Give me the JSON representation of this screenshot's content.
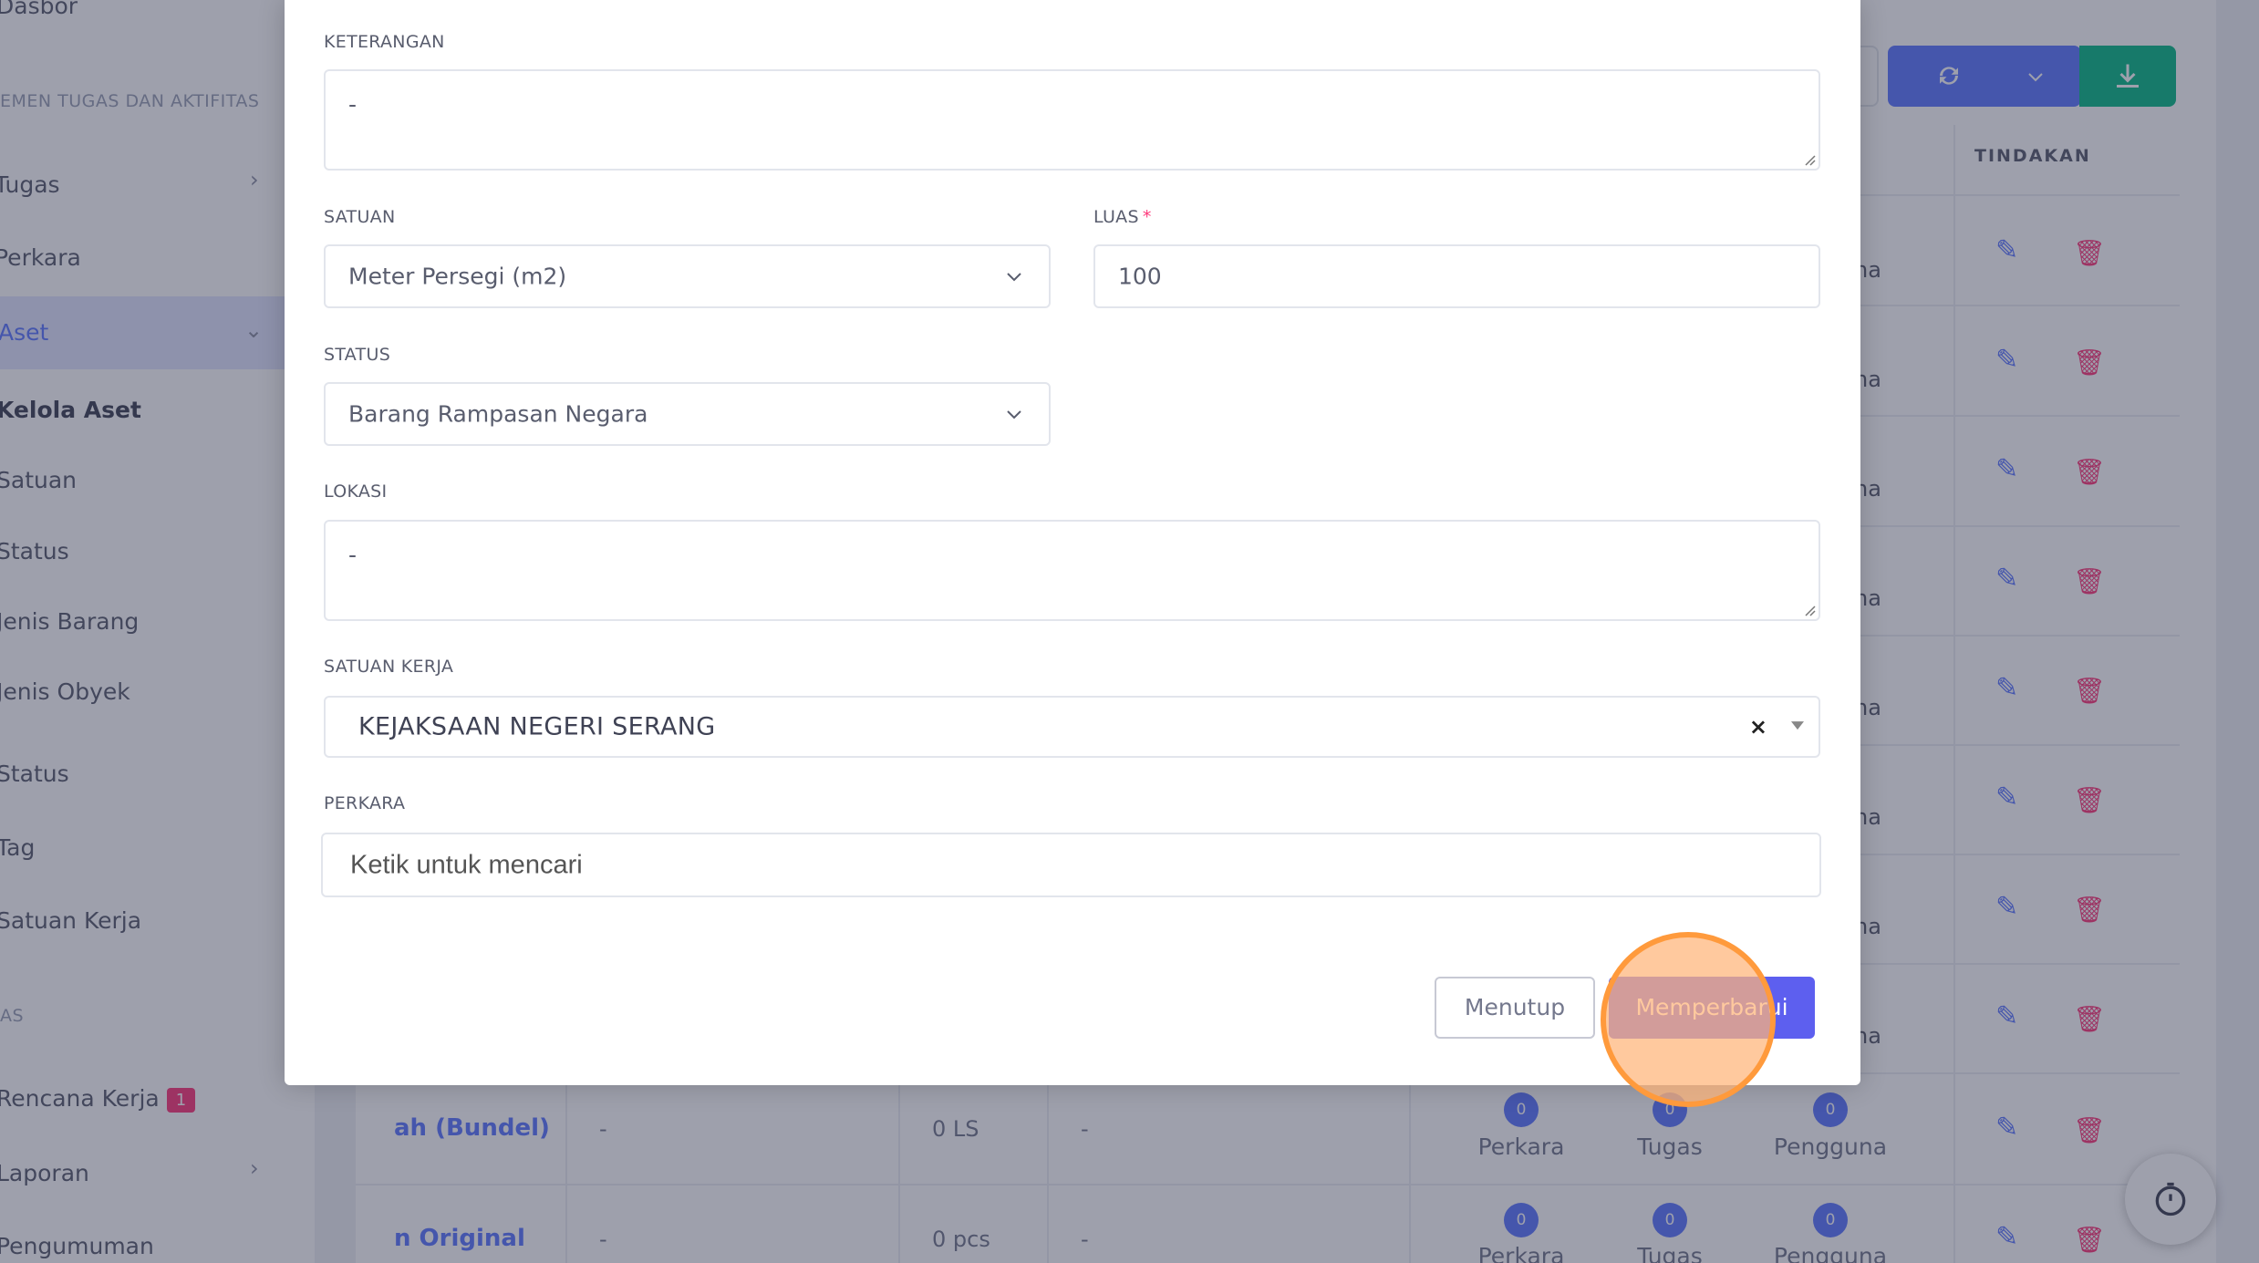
{
  "sidebar": {
    "items": [
      {
        "label": "Dasbor"
      },
      {
        "label": "Tugas"
      },
      {
        "label": "Perkara"
      },
      {
        "label": "Aset"
      },
      {
        "label": "Kelola Aset"
      },
      {
        "label": "Satuan"
      },
      {
        "label": "Status"
      },
      {
        "label": "Jenis Barang"
      },
      {
        "label": "Jenis Obyek"
      },
      {
        "label": "Status"
      },
      {
        "label": "Tag"
      },
      {
        "label": "Satuan Kerja"
      },
      {
        "label": "Rencana Kerja",
        "badge": "1"
      },
      {
        "label": "Laporan"
      },
      {
        "label": "Pengumuman"
      }
    ],
    "section_tasks": "EMEN TUGAS DAN AKTIFITAS",
    "section_other": "AS"
  },
  "table": {
    "column_actions": "TINDAKAN",
    "row_fragment": "na",
    "rows_visible": [
      {
        "name": "ah (Bundel)",
        "col2": "-",
        "qty": "0 LS",
        "col4": "-",
        "perkara": "0",
        "tugas": "0",
        "pengguna": "0"
      },
      {
        "name": "n Original",
        "col2": "-",
        "qty": "0 pcs",
        "col4": "-",
        "perkara": "0",
        "tugas": "0",
        "pengguna": "0"
      }
    ],
    "count_labels": {
      "perkara": "Perkara",
      "tugas": "Tugas",
      "pengguna": "Pengguna"
    }
  },
  "modal": {
    "keterangan": {
      "label": "KETERANGAN",
      "value": "-"
    },
    "satuan": {
      "label": "SATUAN",
      "value": "Meter Persegi (m2)"
    },
    "luas": {
      "label": "LUAS",
      "required_mark": "*",
      "value": "100"
    },
    "status": {
      "label": "STATUS",
      "value": "Barang Rampasan Negara"
    },
    "lokasi": {
      "label": "LOKASI",
      "value": "-"
    },
    "satuan_kerja": {
      "label": "SATUAN KERJA",
      "value": "KEJAKSAAN NEGERI SERANG",
      "clear": "×"
    },
    "perkara": {
      "label": "PERKARA",
      "placeholder": "Ketik untuk mencari"
    },
    "close_label": "Menutup",
    "update_label": "Memperbarui"
  },
  "colors": {
    "primary": "#5d78ff",
    "update_button": "#5d5fef",
    "danger": "#fd397a",
    "success": "#0abb87",
    "click_highlight": "#ff9a3c"
  },
  "icons": [
    "chevron-down-icon",
    "refresh-icon",
    "download-icon",
    "edit-icon",
    "trash-icon",
    "timer-icon",
    "clear-icon"
  ]
}
